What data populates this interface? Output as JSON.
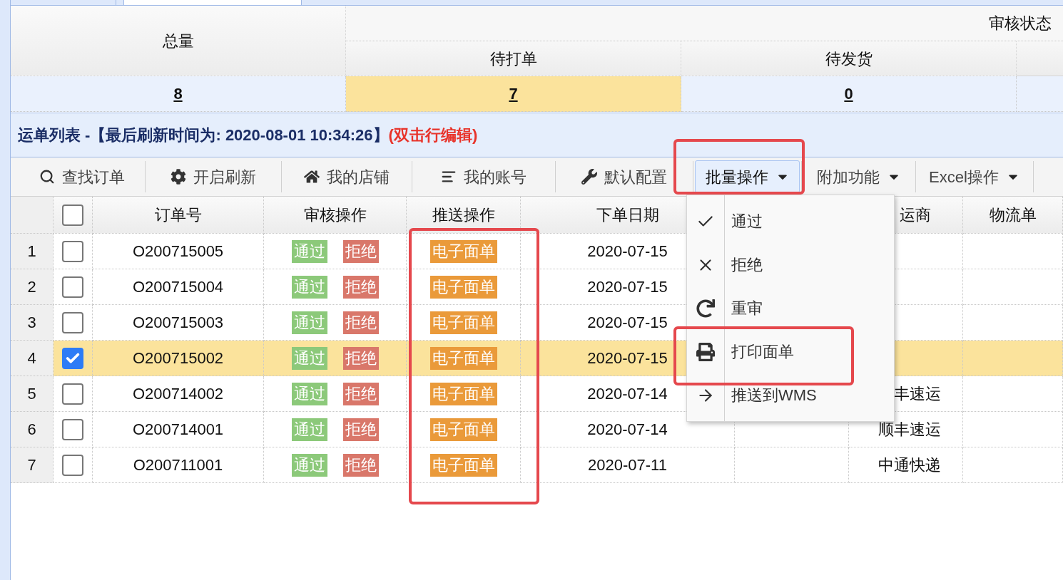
{
  "summary": {
    "total_label": "总量",
    "group_label": "审核状态",
    "columns": [
      {
        "label": "待打单"
      },
      {
        "label": "待发货"
      }
    ],
    "values": [
      {
        "value": "8",
        "selected": false
      },
      {
        "value": "7",
        "selected": true
      },
      {
        "value": "0",
        "selected": false
      }
    ]
  },
  "list_title": {
    "text": "运单列表 -【最后刷新时间为: 2020-08-01 10:34:26】",
    "hint": "(双击行编辑)"
  },
  "toolbar": [
    {
      "label": "查找订单",
      "kind": "button",
      "expanded": false
    },
    {
      "label": "开启刷新",
      "kind": "button",
      "expanded": false
    },
    {
      "label": "我的店铺",
      "kind": "button",
      "expanded": false
    },
    {
      "label": "我的账号",
      "kind": "button",
      "expanded": false
    },
    {
      "label": "默认配置",
      "kind": "button",
      "expanded": false
    },
    {
      "label": "批量操作",
      "kind": "dropdown",
      "expanded": true
    },
    {
      "label": "附加功能",
      "kind": "dropdown",
      "expanded": false
    },
    {
      "label": "Excel操作",
      "kind": "dropdown",
      "expanded": false
    }
  ],
  "table": {
    "all_checked": false,
    "columns": [
      "订单号",
      "审核操作",
      "推送操作",
      "下单日期",
      "运商",
      "物流单"
    ],
    "rows": [
      {
        "number": "1",
        "checked": false,
        "selected": false,
        "order": "O200715005",
        "approve": "通过",
        "reject": "拒绝",
        "push": "电子面单",
        "date": "2020-07-15"
      },
      {
        "number": "2",
        "checked": false,
        "selected": false,
        "order": "O200715004",
        "approve": "通过",
        "reject": "拒绝",
        "push": "电子面单",
        "date": "2020-07-15"
      },
      {
        "number": "3",
        "checked": false,
        "selected": false,
        "order": "O200715003",
        "approve": "通过",
        "reject": "拒绝",
        "push": "电子面单",
        "date": "2020-07-15"
      },
      {
        "number": "4",
        "checked": true,
        "selected": true,
        "order": "O200715002",
        "approve": "通过",
        "reject": "拒绝",
        "push": "电子面单",
        "date": "2020-07-15"
      },
      {
        "number": "5",
        "checked": false,
        "selected": false,
        "order": "O200714002",
        "approve": "通过",
        "reject": "拒绝",
        "push": "电子面单",
        "date": "2020-07-14",
        "carrier": "丰速运"
      },
      {
        "number": "6",
        "checked": false,
        "selected": false,
        "order": "O200714001",
        "approve": "通过",
        "reject": "拒绝",
        "push": "电子面单",
        "date": "2020-07-14",
        "carrier": "顺丰速运"
      },
      {
        "number": "7",
        "checked": false,
        "selected": false,
        "order": "O200711001",
        "approve": "通过",
        "reject": "拒绝",
        "push": "电子面单",
        "date": "2020-07-11",
        "carrier": "中通快递"
      }
    ]
  },
  "menu": {
    "items": [
      {
        "label": "通过"
      },
      {
        "label": "拒绝"
      },
      {
        "label": "重审"
      },
      {
        "label": "打印面单"
      },
      {
        "label": "推送到WMS"
      }
    ]
  }
}
